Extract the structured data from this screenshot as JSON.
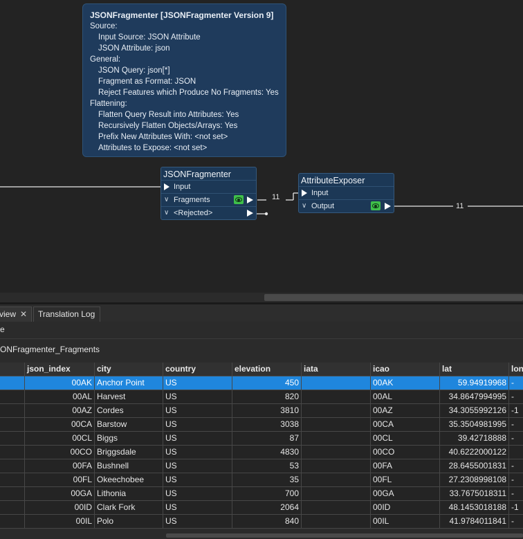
{
  "annotation": {
    "title": "JSONFragmenter [JSONFragmenter Version 9]",
    "lines": [
      {
        "text": "Source:",
        "indent": false
      },
      {
        "text": "Input Source: JSON Attribute",
        "indent": true
      },
      {
        "text": "JSON Attribute: json",
        "indent": true
      },
      {
        "text": "General:",
        "indent": false
      },
      {
        "text": "JSON Query: json[*]",
        "indent": true
      },
      {
        "text": "Fragment as Format: JSON",
        "indent": true
      },
      {
        "text": "Reject Features which Produce No Fragments: Yes",
        "indent": true
      },
      {
        "text": "Flattening:",
        "indent": false
      },
      {
        "text": "Flatten Query Result into Attributes: Yes",
        "indent": true
      },
      {
        "text": "Recursively Flatten Objects/Arrays: Yes",
        "indent": true
      },
      {
        "text": "Prefix New Attributes With: <not set>",
        "indent": true
      },
      {
        "text": "Attributes to Expose: <not set>",
        "indent": true
      }
    ]
  },
  "nodes": {
    "fragmenter": {
      "title": "JSONFragmenter",
      "input": "Input",
      "fragments": "Fragments",
      "rejected": "<Rejected>"
    },
    "exposer": {
      "title": "AttributeExposer",
      "input": "Input",
      "output": "Output"
    }
  },
  "connections": {
    "fragments_count": "11",
    "output_count": "11"
  },
  "panel": {
    "tabs": [
      {
        "label": "view",
        "closable": true,
        "active": true
      },
      {
        "label": "Translation Log",
        "closable": false,
        "active": false
      }
    ],
    "toolbar_text": "e",
    "feature_type": "ONFragmenter_Fragments"
  },
  "table": {
    "columns": [
      "",
      "json_index",
      "city",
      "country",
      "elevation",
      "iata",
      "icao",
      "lat",
      "lon"
    ],
    "rows": [
      [
        "",
        "00AK",
        "Anchor Point",
        "US",
        "450",
        "",
        "00AK",
        "59.94919968",
        "-"
      ],
      [
        "",
        "00AL",
        "Harvest",
        "US",
        "820",
        "",
        "00AL",
        "34.8647994995",
        "-"
      ],
      [
        "",
        "00AZ",
        "Cordes",
        "US",
        "3810",
        "",
        "00AZ",
        "34.3055992126",
        "-1"
      ],
      [
        "",
        "00CA",
        "Barstow",
        "US",
        "3038",
        "",
        "00CA",
        "35.3504981995",
        "-"
      ],
      [
        "",
        "00CL",
        "Biggs",
        "US",
        "87",
        "",
        "00CL",
        "39.42718888",
        "-"
      ],
      [
        "",
        "00CO",
        "Briggsdale",
        "US",
        "4830",
        "",
        "00CO",
        "40.6222000122",
        ""
      ],
      [
        "",
        "00FA",
        "Bushnell",
        "US",
        "53",
        "",
        "00FA",
        "28.6455001831",
        "-"
      ],
      [
        "",
        "00FL",
        "Okeechobee",
        "US",
        "35",
        "",
        "00FL",
        "27.2308998108",
        "-"
      ],
      [
        "",
        "00GA",
        "Lithonia",
        "US",
        "700",
        "",
        "00GA",
        "33.7675018311",
        "-"
      ],
      [
        "",
        "00ID",
        "Clark Fork",
        "US",
        "2064",
        "",
        "00ID",
        "48.1453018188",
        "-1"
      ],
      [
        "",
        "00IL",
        "Polo",
        "US",
        "840",
        "",
        "00IL",
        "41.9784011841",
        "-"
      ]
    ],
    "selected_row": 0
  }
}
